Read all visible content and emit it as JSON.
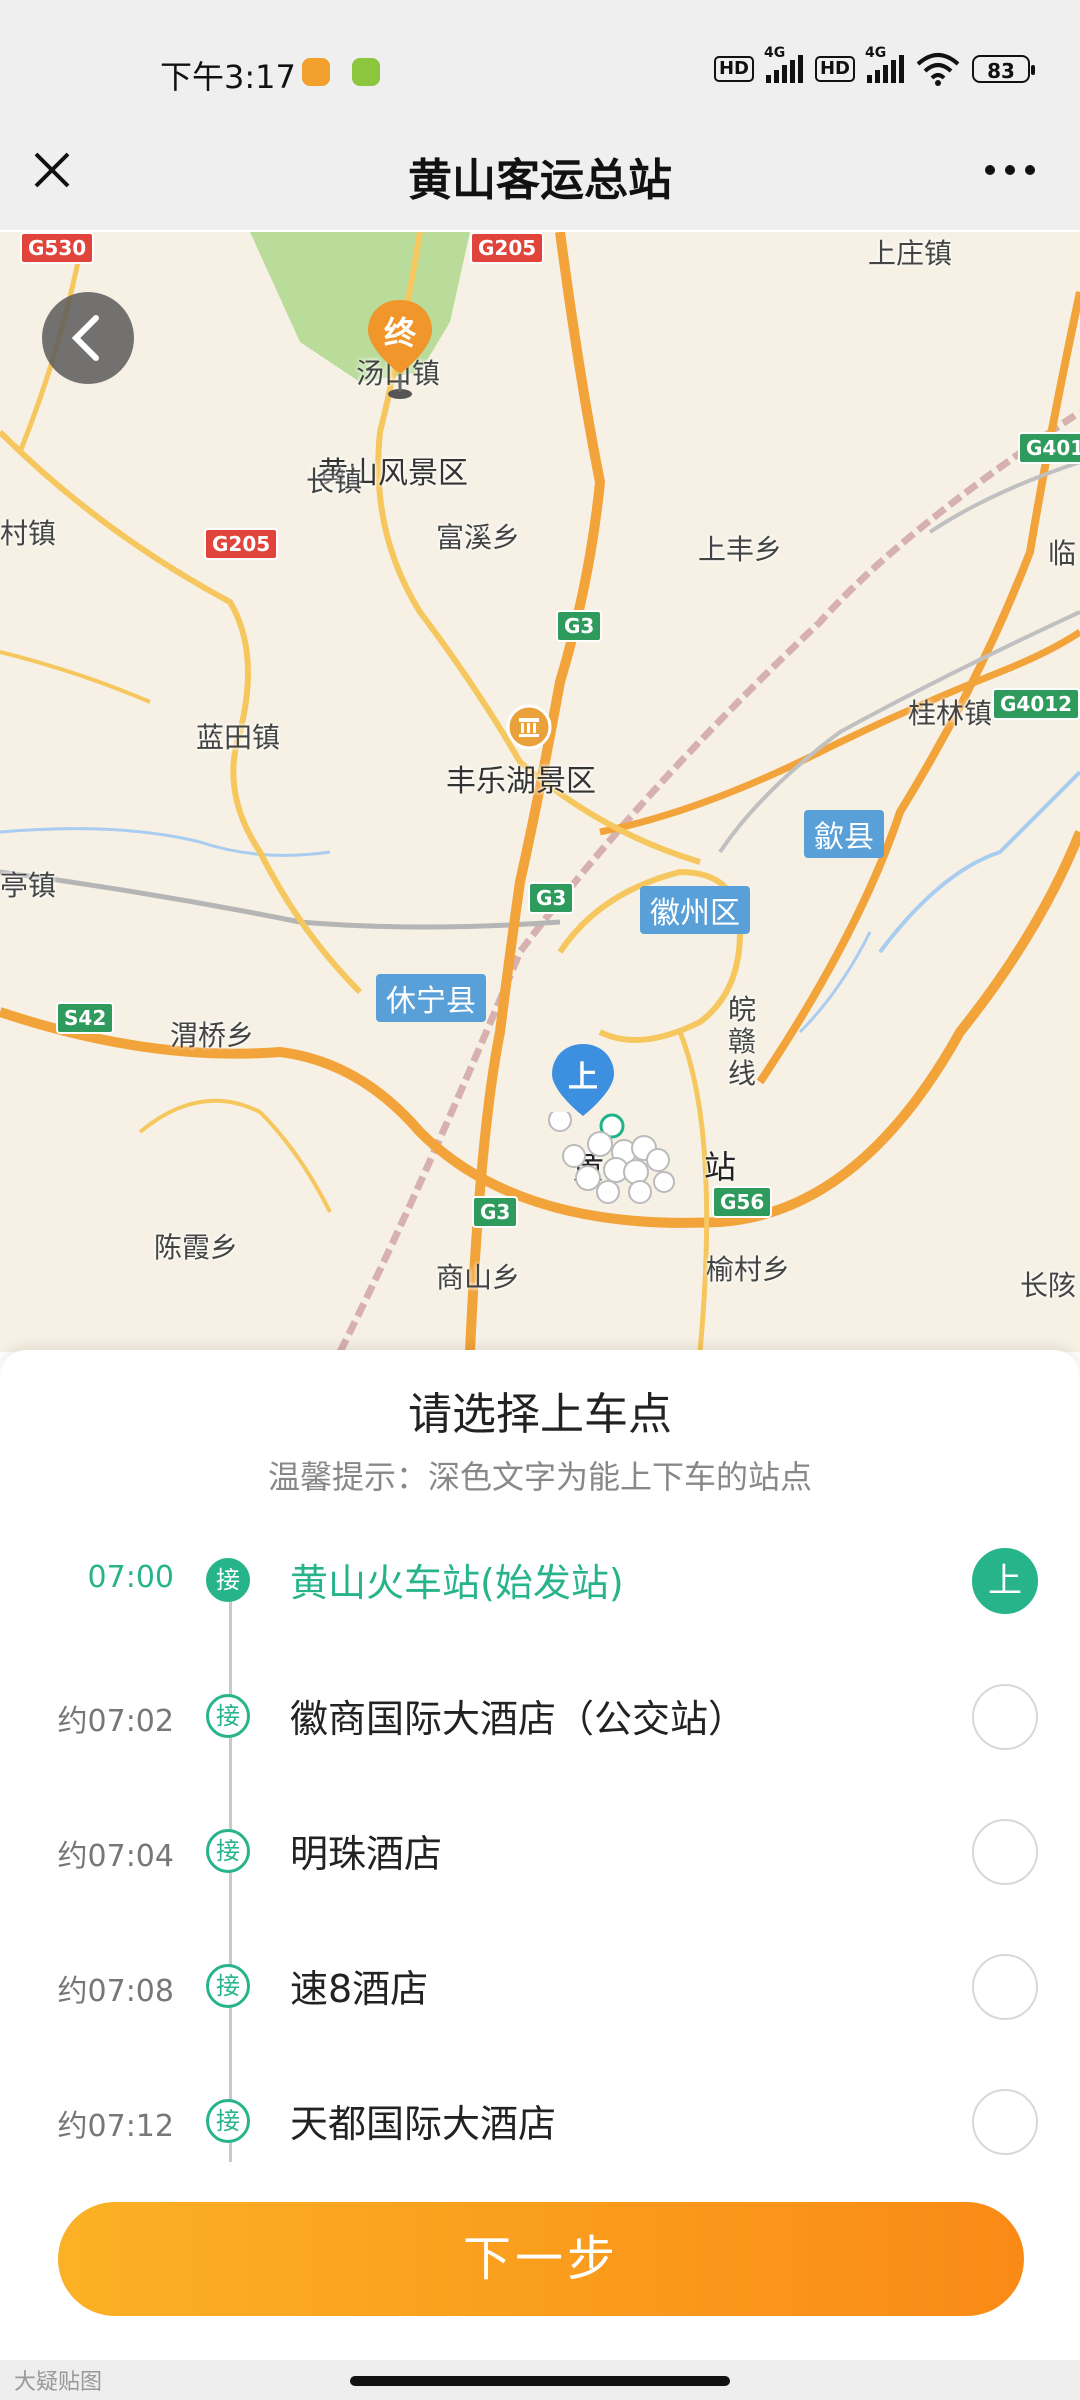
{
  "status_bar": {
    "time": "下午3:17",
    "signal1_tag": "4G",
    "signal2_tag": "4G",
    "hd1": "HD",
    "hd2": "HD",
    "battery": "83",
    "icons": [
      "notification-app-icon",
      "android-icon",
      "wifi-icon"
    ]
  },
  "header": {
    "title": "黄山客运总站",
    "close_icon": "close-icon",
    "more_icon": "more-icon"
  },
  "map": {
    "back_icon": "chevron-left-icon",
    "end_marker": "终",
    "start_marker": "上",
    "labels": {
      "shangzhuang": "上庄镇",
      "tangkou": "汤口镇",
      "scenic": "黄山风景区",
      "changzhen": "长镇",
      "cunzhen": "村镇",
      "fuxi": "富溪乡",
      "shangfeng": "上丰乡",
      "lin": "临",
      "guilin": "桂林镇",
      "lantian": "蓝田镇",
      "fengle": "丰乐湖景区",
      "tingzhen": "亭镇",
      "weiqiao": "渭桥乡",
      "wan": "皖",
      "gan": "赣",
      "xian": "线",
      "huang": "黄",
      "zhan": "站",
      "chenxia": "陈霞乡",
      "shangshan": "商山乡",
      "yucun": "榆村乡",
      "changgai": "长陔"
    },
    "roads": {
      "g530": "G530",
      "g205a": "G205",
      "g205b": "G205",
      "g401": "G401",
      "g4012": "G4012",
      "g3a": "G3",
      "g3b": "G3",
      "g3c": "G3",
      "s42": "S42",
      "g56": "G56"
    },
    "districts": {
      "shexian": "歙县",
      "huizhou": "徽州区",
      "xiuning": "休宁县"
    }
  },
  "sheet": {
    "title": "请选择上车点",
    "hint": "温馨提示：深色文字为能上下车的站点",
    "badge_label": "接",
    "selected_label": "上",
    "stops": [
      {
        "time": "07:00",
        "name": "黄山火车站(始发站)",
        "selected": true
      },
      {
        "time": "约07:02",
        "name": "徽商国际大酒店（公交站）",
        "selected": false
      },
      {
        "time": "约07:04",
        "name": "明珠酒店",
        "selected": false
      },
      {
        "time": "约07:08",
        "name": "速8酒店",
        "selected": false
      },
      {
        "time": "约07:12",
        "name": "天都国际大酒店",
        "selected": false
      }
    ],
    "next_button": "下一步"
  },
  "footer": {
    "watermark": "大疑贴图"
  },
  "colors": {
    "accent_green": "#27b48a",
    "button_orange_start": "#fbb125",
    "button_orange_end": "#fa8a16",
    "marker_blue": "#3d8fe0",
    "marker_orange": "#f0962a"
  }
}
